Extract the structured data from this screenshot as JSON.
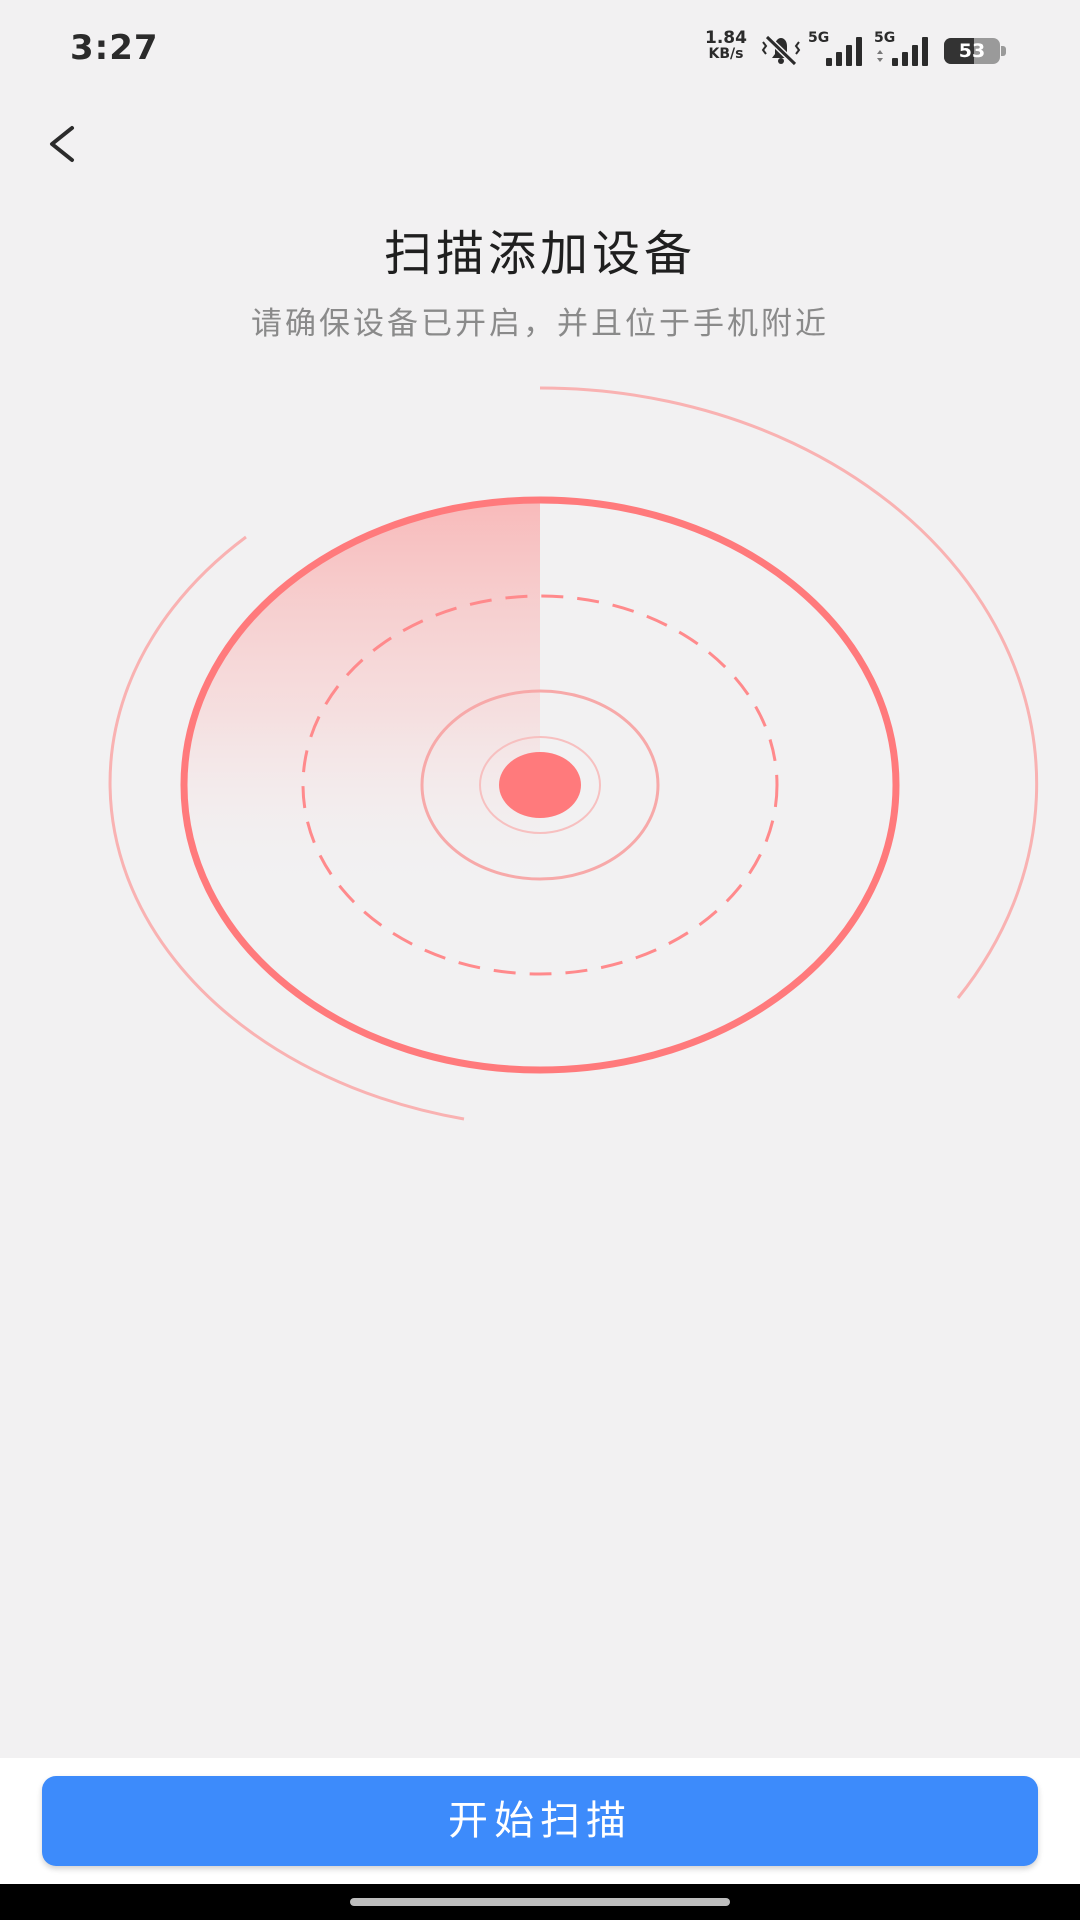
{
  "status_bar": {
    "time": "3:27",
    "net_speed_value": "1.84",
    "net_speed_unit": "KB/s",
    "signal1_label": "5G",
    "signal2_label": "5G",
    "battery_level": "53",
    "icons": [
      "mute-bell-icon",
      "signal-icon",
      "signal-icon",
      "battery-icon"
    ]
  },
  "header": {
    "back_icon": "chevron-left-icon",
    "title": "扫描添加设备",
    "subtitle": "请确保设备已开启，并且位于手机附近"
  },
  "radar": {
    "accent_color": "#ff7a7c",
    "dot_color": "#ff7a7c",
    "arc_color": "#f9b2b2"
  },
  "actions": {
    "start_scan_label": "开始扫描",
    "button_color": "#3d8bfb"
  }
}
